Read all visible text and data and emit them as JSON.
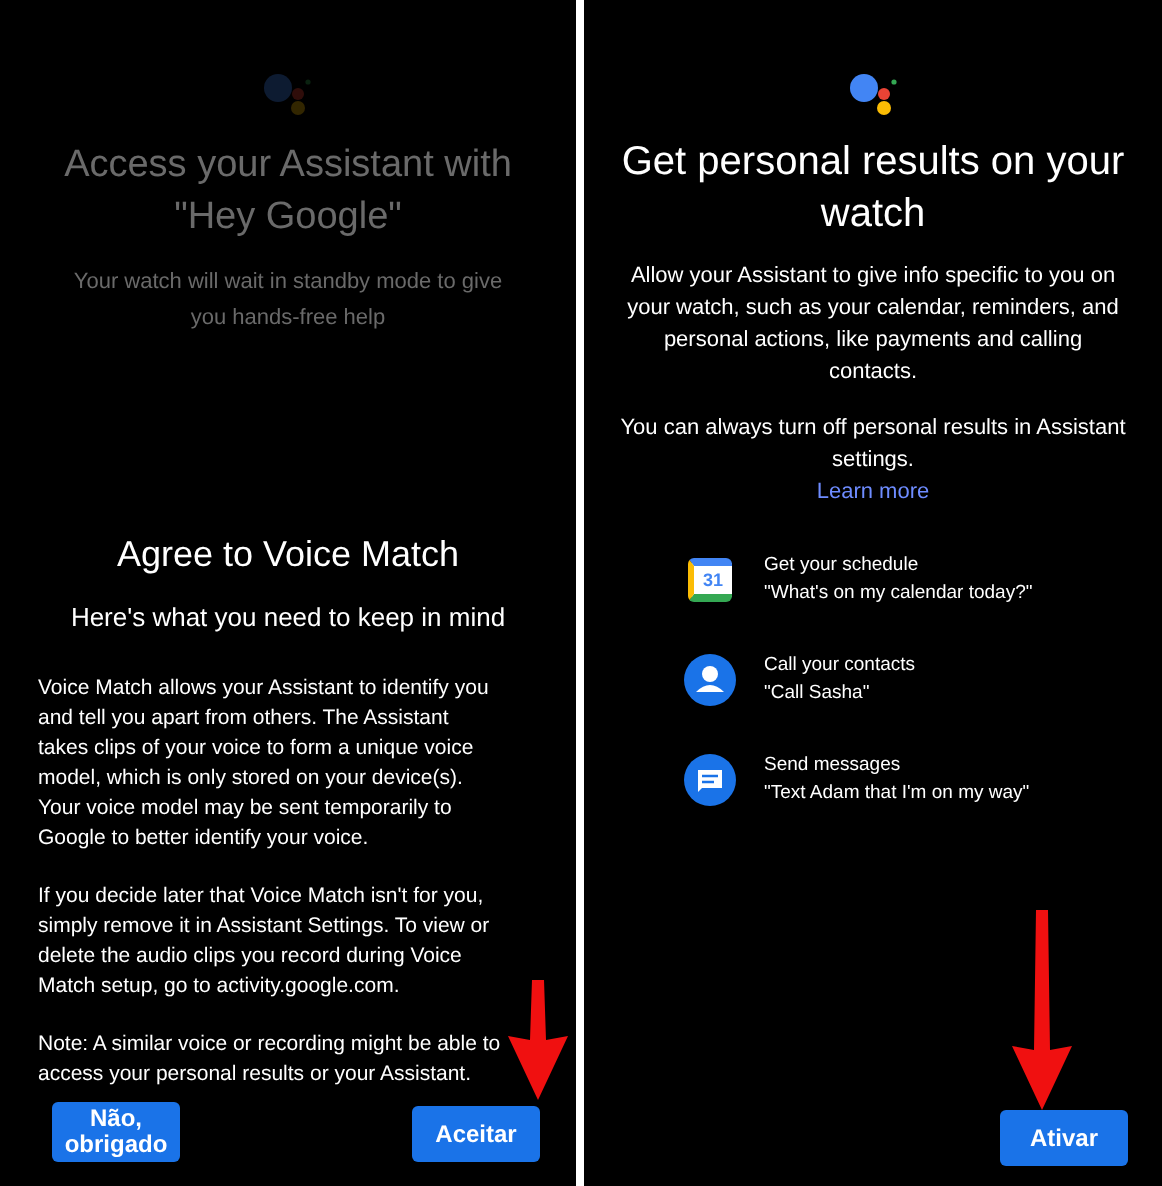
{
  "left_screen": {
    "fading_header": {
      "faded": true,
      "title": "Access your Assistant with \"Hey Google\"",
      "subtitle": "Your watch will wait in standby mode to give you hands-free help"
    },
    "title": "Agree to Voice Match",
    "subtitle": "Here's what you need to keep in mind",
    "paragraphs": [
      "Voice Match allows your Assistant to identify you and tell you apart from others. The Assistant takes clips of your voice to form a unique voice model, which is only stored on your device(s). Your voice model may be sent temporarily to Google to better identify your voice.",
      "If you decide later that Voice Match isn't for you, simply remove it in Assistant Settings. To view or delete the audio clips you record during Voice Match setup, go to activity.google.com.",
      "Note: A similar voice or recording might be able to access your personal results or your Assistant."
    ],
    "buttons": [
      "Não, obrigado",
      "Aceitar"
    ]
  },
  "right_screen": {
    "title": "Get personal results on your watch",
    "paragraphs": [
      "Allow your Assistant to give info specific to you on your watch, such as your calendar, reminders, and personal actions, like payments and calling contacts.",
      "You can always turn off personal results in Assistant settings."
    ],
    "link": "Learn more",
    "features": [
      {
        "kind": "calendar",
        "icon_text": "31",
        "title": "Get your schedule",
        "example": "\"What's on my calendar today?\""
      },
      {
        "kind": "contact",
        "title": "Call your contacts",
        "example": "\"Call Sasha\""
      },
      {
        "kind": "message",
        "title": "Send messages",
        "example": "\"Text Adam that I'm on my way\""
      }
    ],
    "button": "Ativar"
  }
}
